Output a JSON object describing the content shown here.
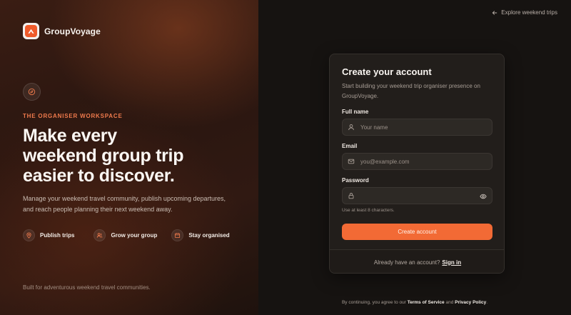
{
  "brand": {
    "name": "GroupVoyage"
  },
  "hero": {
    "eyebrow": "THE ORGANISER WORKSPACE",
    "title_lines": [
      "Make every",
      "weekend group trip",
      "easier to discover."
    ],
    "description": "Manage your weekend travel community, publish upcoming departures, and reach people planning their next weekend away.",
    "features": [
      {
        "label": "Publish trips",
        "icon": "map-pin-icon"
      },
      {
        "label": "Grow your group",
        "icon": "users-icon"
      },
      {
        "label": "Stay organised",
        "icon": "calendar-icon"
      }
    ],
    "footer": "Built for adventurous weekend travel communities."
  },
  "nav": {
    "explore_link": "Explore weekend trips"
  },
  "form": {
    "title": "Create your account",
    "subtitle": "Start building your weekend trip organiser presence on GroupVoyage.",
    "full_name": {
      "label": "Full name",
      "placeholder": "Your name",
      "value": ""
    },
    "email": {
      "label": "Email",
      "placeholder": "you@example.com",
      "value": ""
    },
    "password": {
      "label": "Password",
      "placeholder": "",
      "value": "",
      "hint": "Use at least 8 characters."
    },
    "submit_label": "Create account",
    "signin_prompt": "Already have an account?",
    "signin_link": "Sign in"
  },
  "legal": {
    "prefix": "By continuing, you agree to our",
    "terms": "Terms of Service",
    "and": "and",
    "privacy": "Privacy Policy",
    "suffix": "."
  },
  "colors": {
    "accent": "#f26a35",
    "eyebrow": "#ef7a4c",
    "background": "#161311",
    "card": "#221e1b"
  }
}
